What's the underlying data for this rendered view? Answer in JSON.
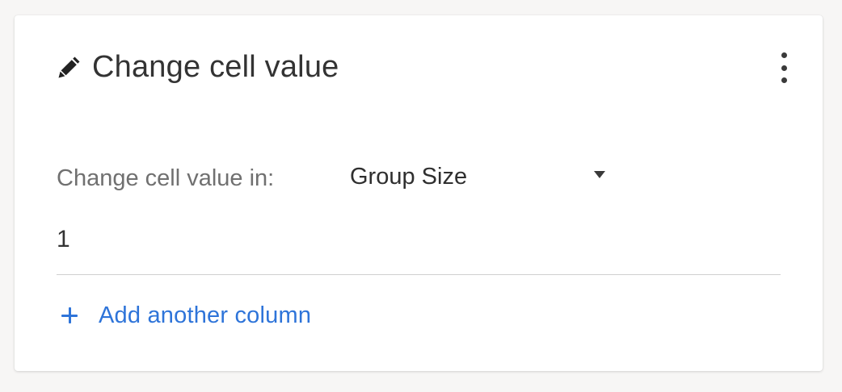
{
  "card": {
    "title": "Change cell value",
    "field_label": "Change cell value in:",
    "column_select": {
      "selected": "Group Size"
    },
    "value": "1",
    "add_column_label": "Add another column"
  },
  "icons": {
    "title_icon": "pencil-icon",
    "menu_icon": "more-vertical-icon",
    "select_icon": "caret-down-icon",
    "add_icon": "plus-icon"
  },
  "colors": {
    "accent": "#2e74d9",
    "title": "#333333",
    "label": "#707070",
    "background": "#f7f6f5",
    "card": "#ffffff"
  }
}
